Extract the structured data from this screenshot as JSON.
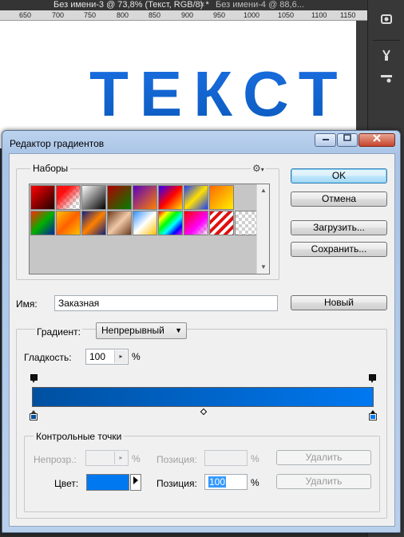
{
  "ps": {
    "tab_active": "Без имени-3 @ 73,8% (Текст, RGB/8) *",
    "tab_inactive": "Без имени-4 @ 88,6...",
    "close_glyph": "×",
    "ruler_ticks": [
      "650",
      "700",
      "750",
      "800",
      "850",
      "900",
      "950",
      "1000",
      "1050",
      "1100",
      "1150"
    ],
    "canvas_text": "ТЕКСТ"
  },
  "dialog": {
    "title": "Редактор градиентов",
    "presets_label": "Наборы",
    "gear_glyph": "⚙",
    "buttons": {
      "ok": "OK",
      "cancel": "Отмена",
      "load": "Загрузить...",
      "save": "Сохранить...",
      "new": "Новый",
      "delete1": "Удалить",
      "delete2": "Удалить"
    },
    "name_label": "Имя:",
    "name_value": "Заказная",
    "gradient_label": "Градиент:",
    "gradient_type": "Непрерывный",
    "smoothness_label": "Гладкость:",
    "smoothness_value": "100",
    "percent": "%",
    "stops_label": "Контрольные точки",
    "opacity_label": "Непрозр.:",
    "position_label_disabled": "Позиция:",
    "color_label": "Цвет:",
    "position_label": "Позиция:",
    "position_value": "100"
  },
  "colors": {
    "gradient_start": "#0050a0",
    "gradient_end": "#0078f0",
    "selected_stop_color": "#0078f0"
  }
}
